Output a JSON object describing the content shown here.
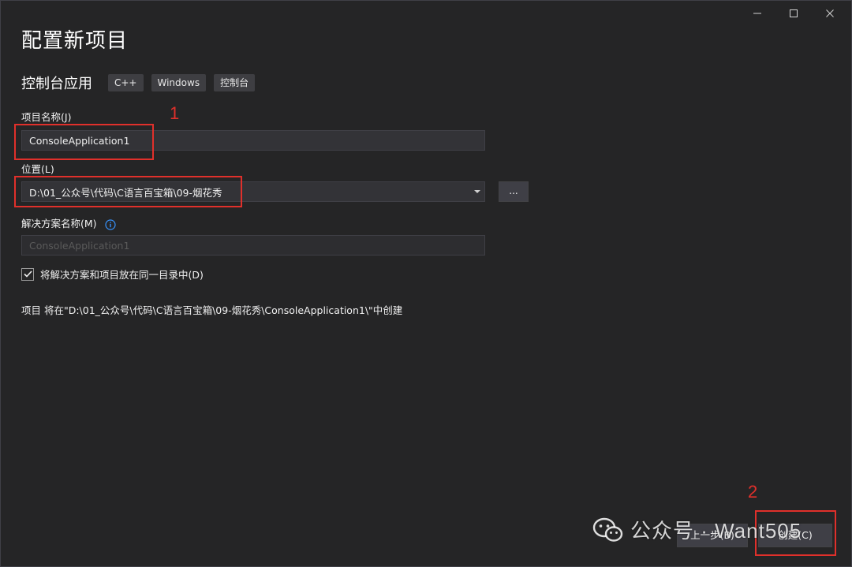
{
  "window_controls": {
    "minimize_icon": "minimize-icon",
    "maximize_icon": "maximize-icon",
    "close_icon": "close-icon"
  },
  "header": {
    "title": "配置新项目",
    "template_name": "控制台应用",
    "tags": [
      "C++",
      "Windows",
      "控制台"
    ]
  },
  "form": {
    "project_name_label": "项目名称(J)",
    "project_name_value": "ConsoleApplication1",
    "location_label": "位置(L)",
    "location_value": "D:\\01_公众号\\代码\\C语言百宝箱\\09-烟花秀",
    "browse_label": "...",
    "solution_name_label": "解决方案名称(M)",
    "solution_name_value": "ConsoleApplication1",
    "same_dir_label": "将解决方案和项目放在同一目录中(D)",
    "same_dir_checked": true,
    "path_info": "项目 将在\"D:\\01_公众号\\代码\\C语言百宝箱\\09-烟花秀\\ConsoleApplication1\\\"中创建"
  },
  "footer": {
    "back_label": "上一步(B)",
    "create_label": "创建(C)"
  },
  "annotations": {
    "marker_1": "1",
    "marker_2": "2",
    "color": "#e0302b"
  },
  "watermark": {
    "text": "公众号 · Want505",
    "icon": "wechat-icon"
  },
  "colors": {
    "background": "#252526",
    "input_bg": "#333337",
    "button_bg": "#3f3f46",
    "text": "#f1f1f1",
    "info_icon": "#3794ff"
  }
}
